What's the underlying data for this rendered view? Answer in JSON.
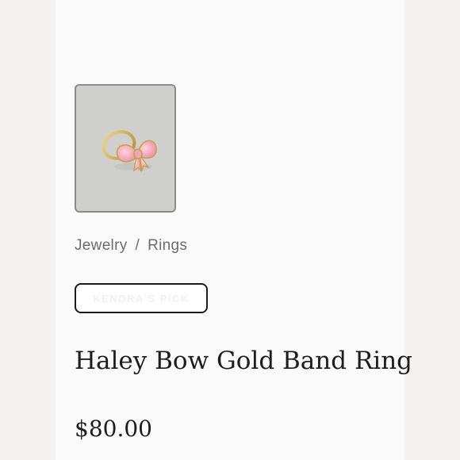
{
  "product": {
    "image_label": "ring-icon",
    "breadcrumb": {
      "category": "Jewelry",
      "separator": "/",
      "subcategory": "Rings"
    },
    "badge": "KENDRA'S PICK",
    "title": "Haley Bow Gold Band Ring",
    "price": "$80.00"
  },
  "colors": {
    "background": "#f4f1f1",
    "panel": "#fbfafa",
    "thumb_bg": "#cfcfce",
    "bow_pink": "#f3a5b8",
    "gold": "#d7b24f",
    "text": "#1d1d1d"
  }
}
